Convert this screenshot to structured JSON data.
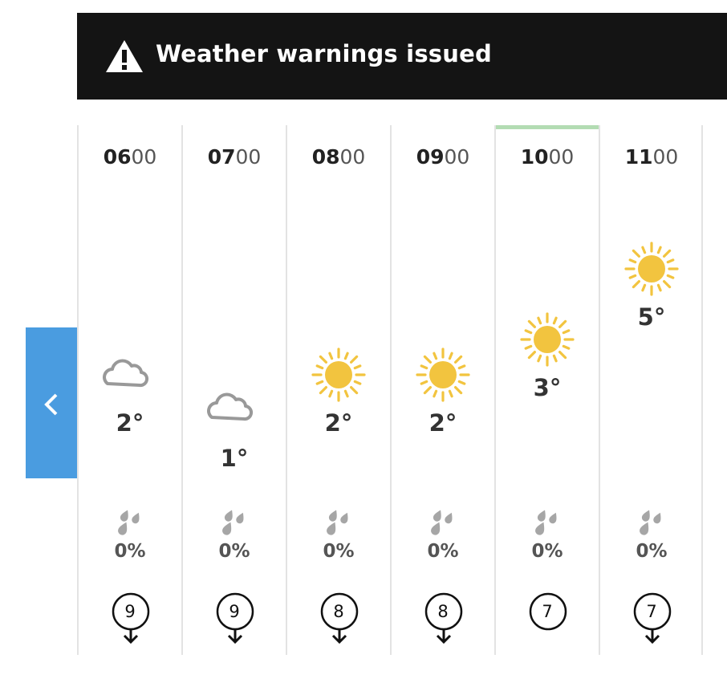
{
  "banner": {
    "text": "Weather warnings issued",
    "icon": "warning-triangle-icon"
  },
  "nav": {
    "prev_icon": "chevron-left-icon"
  },
  "colors": {
    "banner_bg": "#141414",
    "nav_bg": "#4a9ce0",
    "selected": "#b3dcb3",
    "sun": "#f2c43f",
    "cloud": "#999999"
  },
  "hours": [
    {
      "hour": "06",
      "mins": "00",
      "icon": "partly-cloudy-night-icon",
      "temp": "2°",
      "rain_chance": "0%",
      "wind": "9",
      "wind_arrow": true,
      "selected": false
    },
    {
      "hour": "07",
      "mins": "00",
      "icon": "partly-cloudy-night-icon",
      "temp": "1°",
      "rain_chance": "0%",
      "wind": "9",
      "wind_arrow": true,
      "selected": false
    },
    {
      "hour": "08",
      "mins": "00",
      "icon": "sunny-icon",
      "temp": "2°",
      "rain_chance": "0%",
      "wind": "8",
      "wind_arrow": true,
      "selected": false
    },
    {
      "hour": "09",
      "mins": "00",
      "icon": "sunny-icon",
      "temp": "2°",
      "rain_chance": "0%",
      "wind": "8",
      "wind_arrow": true,
      "selected": false
    },
    {
      "hour": "10",
      "mins": "00",
      "icon": "sunny-icon",
      "temp": "3°",
      "rain_chance": "0%",
      "wind": "7",
      "wind_arrow": false,
      "selected": true
    },
    {
      "hour": "11",
      "mins": "00",
      "icon": "sunny-icon",
      "temp": "5°",
      "rain_chance": "0%",
      "wind": "7",
      "wind_arrow": true,
      "selected": false
    }
  ]
}
